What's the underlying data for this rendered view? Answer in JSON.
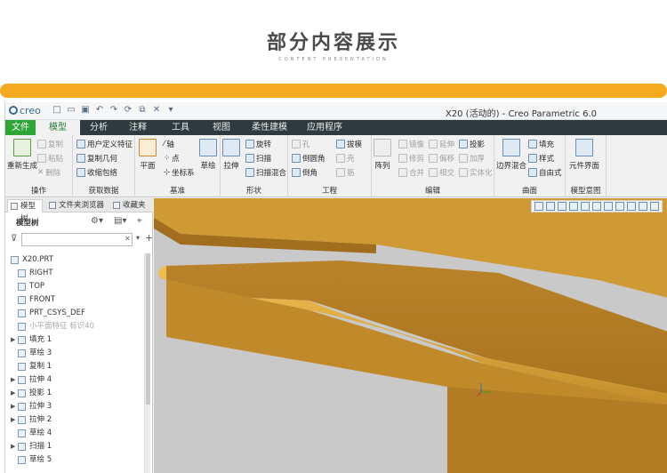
{
  "header": {
    "title": "部分内容展示",
    "subtitle": "CONTENT PRESENTATION"
  },
  "app": {
    "logo": "creo",
    "window_title": "X20 (活动的) - Creo Parametric 6.0"
  },
  "menu": {
    "tabs": [
      "文件",
      "模型",
      "分析",
      "注释",
      "工具",
      "视图",
      "柔性建模",
      "应用程序"
    ],
    "active": "模型"
  },
  "ribbon": {
    "operations": {
      "label": "操作",
      "regen": "重新生成",
      "copy": "复制",
      "paste": "粘贴",
      "delete": "删除"
    },
    "get_data": {
      "label": "获取数据",
      "udf": "用户定义特征",
      "copy_geom": "复制几何",
      "shrinkwrap": "收缩包络"
    },
    "datum": {
      "label": "基准",
      "plane": "平面",
      "axis": "轴",
      "point": "点",
      "csys": "坐标系",
      "sketch": "草绘"
    },
    "shapes": {
      "label": "形状",
      "extrude": "拉伸",
      "revolve": "旋转",
      "sweep": "扫描",
      "swept_blend": "扫描混合"
    },
    "engineering": {
      "label": "工程",
      "hole": "孔",
      "round": "倒圆角",
      "chamfer": "倒角",
      "draft": "拔模",
      "shell": "壳",
      "rib": "筋"
    },
    "editing": {
      "label": "编辑",
      "pattern": "阵列",
      "mirror": "镜像",
      "extend": "延伸",
      "project": "投影",
      "trim": "修剪",
      "offset": "偏移",
      "thicken": "加厚",
      "merge": "合并",
      "intersect": "相交",
      "solidify": "实体化"
    },
    "surfaces": {
      "label": "曲面",
      "boundary_blend": "边界混合",
      "fill": "填充",
      "style": "样式",
      "freestyle": "自由式"
    },
    "model_intent": {
      "label": "模型意图",
      "component_interface": "元件界面"
    }
  },
  "panel": {
    "tabs": [
      "模型树",
      "文件夹浏览器",
      "收藏夹"
    ],
    "tree_title": "模型树",
    "items": [
      {
        "label": "X20.PRT",
        "icon": "part-icon",
        "expand": "",
        "disabled": false,
        "indent": 0
      },
      {
        "label": "RIGHT",
        "icon": "datum-plane-icon",
        "expand": "",
        "disabled": false,
        "indent": 1
      },
      {
        "label": "TOP",
        "icon": "datum-plane-icon",
        "expand": "",
        "disabled": false,
        "indent": 1
      },
      {
        "label": "FRONT",
        "icon": "datum-plane-icon",
        "expand": "",
        "disabled": false,
        "indent": 1
      },
      {
        "label": "PRT_CSYS_DEF",
        "icon": "csys-icon",
        "expand": "",
        "disabled": false,
        "indent": 1
      },
      {
        "label": "小平面特征 标识40",
        "icon": "facet-icon",
        "expand": "",
        "disabled": true,
        "indent": 1
      },
      {
        "label": "填充 1",
        "icon": "fill-icon",
        "expand": "▶",
        "disabled": false,
        "indent": 1
      },
      {
        "label": "草绘 3",
        "icon": "sketch-icon",
        "expand": "",
        "disabled": false,
        "indent": 1
      },
      {
        "label": "复制 1",
        "icon": "copy-icon",
        "expand": "",
        "disabled": false,
        "indent": 1
      },
      {
        "label": "拉伸 4",
        "icon": "extrude-icon",
        "expand": "▶",
        "disabled": false,
        "indent": 1
      },
      {
        "label": "投影 1",
        "icon": "project-icon",
        "expand": "▶",
        "disabled": false,
        "indent": 1
      },
      {
        "label": "拉伸 3",
        "icon": "extrude-icon",
        "expand": "▶",
        "disabled": false,
        "indent": 1
      },
      {
        "label": "拉伸 2",
        "icon": "extrude-icon",
        "expand": "▶",
        "disabled": false,
        "indent": 1
      },
      {
        "label": "草绘 4",
        "icon": "sketch-icon",
        "expand": "",
        "disabled": false,
        "indent": 1
      },
      {
        "label": "扫描 1",
        "icon": "sweep-icon",
        "expand": "▶",
        "disabled": false,
        "indent": 1
      },
      {
        "label": "草绘 5",
        "icon": "sketch-icon",
        "expand": "",
        "disabled": false,
        "indent": 1
      }
    ]
  },
  "colors": {
    "accent_bar": "#f4a91f",
    "menubar": "#2f3a3f",
    "file_tab": "#2fa538",
    "model_color": "#c8942a"
  }
}
